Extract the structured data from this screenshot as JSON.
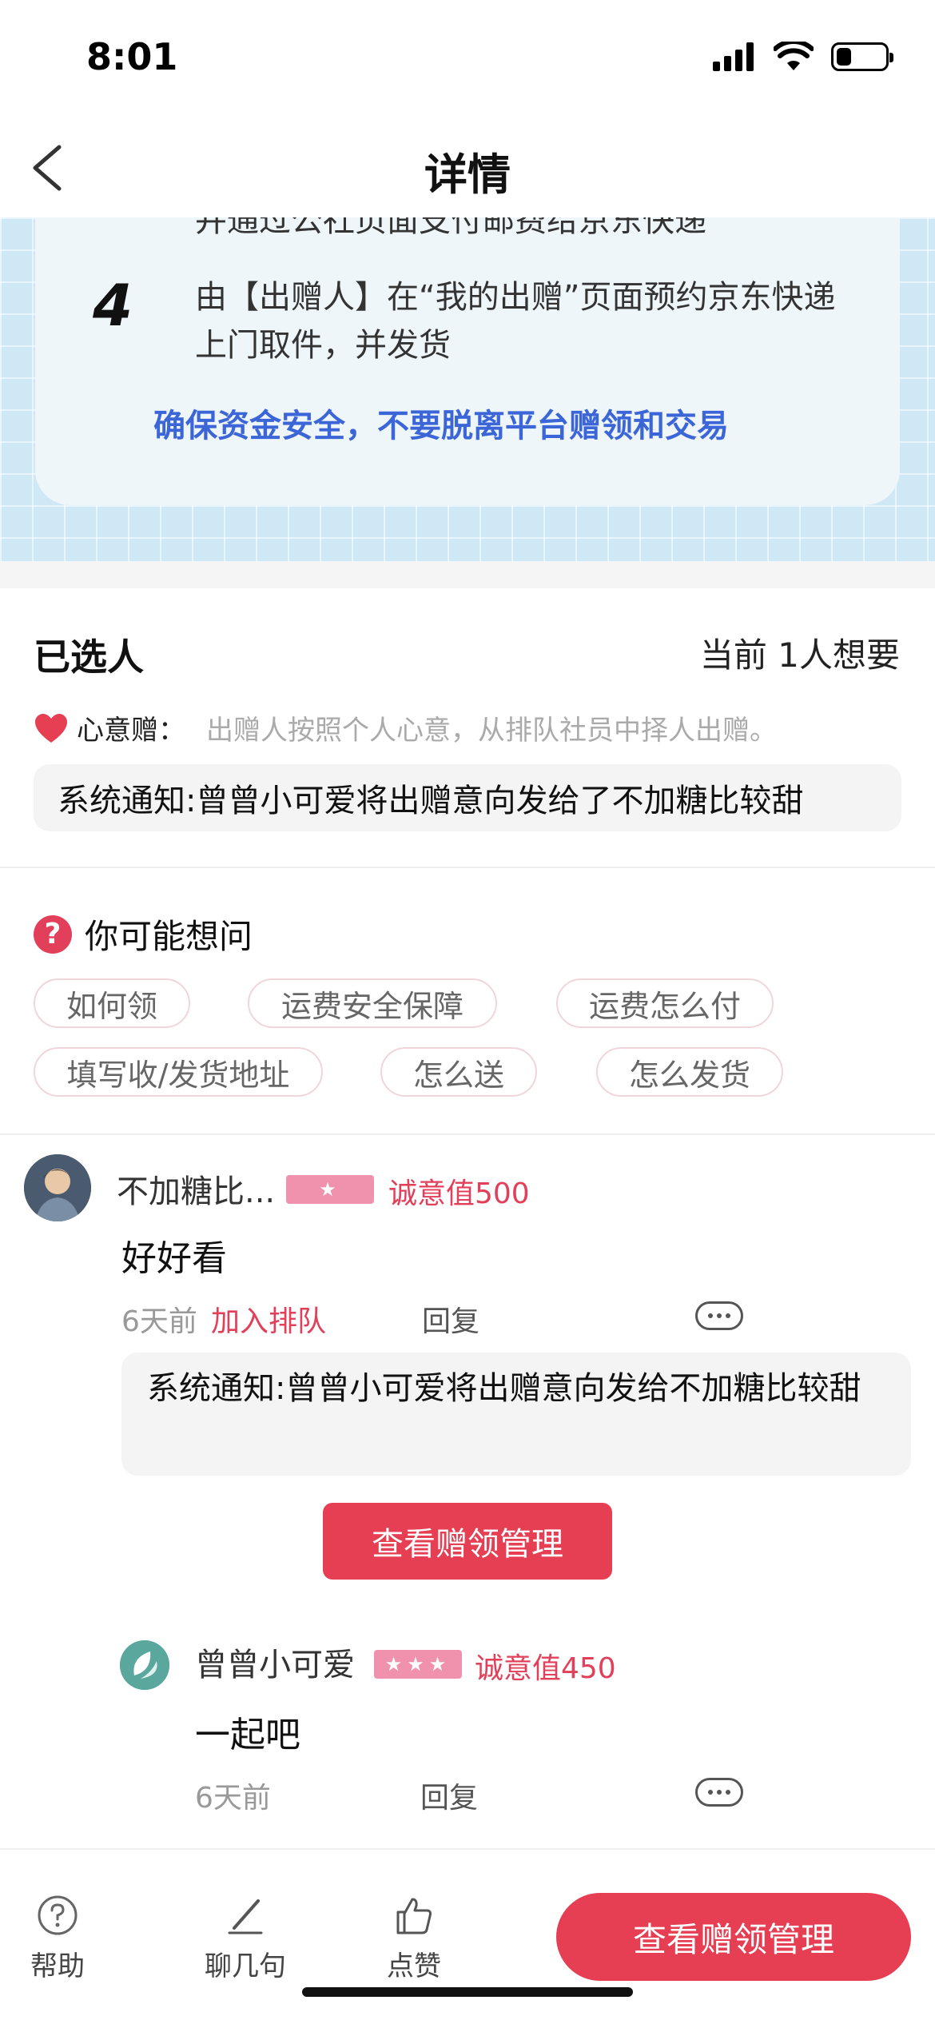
{
  "status": {
    "time": "8:01"
  },
  "nav": {
    "title": "详情"
  },
  "guide": {
    "step3_text": "并通过公社页面支付邮费给京东快递",
    "step4_num": "4",
    "step4_line1": "由【出赠人】在“我的出赠”页面预约京东快递",
    "step4_line2": "上门取件，并发货",
    "warning": "确保资金安全，不要脱离平台赠领和交易"
  },
  "selected": {
    "title": "已选人",
    "count": "当前 1人想要",
    "heart_label": "心意赠：",
    "heart_desc": "出赠人按照个人心意，从排队社员中择人出赠。",
    "notice": "系统通知:曾曾小可爱将出赠意向发给了不加糖比较甜"
  },
  "faq": {
    "title": "你可能想问",
    "chips": [
      "如何领",
      "运费安全保障",
      "运费怎么付",
      "填写收/发货地址",
      "怎么送",
      "怎么发货"
    ]
  },
  "comments": [
    {
      "name": "不加糖比...",
      "sincerity": "诚意值500",
      "text": "好好看",
      "time": "6天前",
      "join": "加入排队",
      "reply": "回复",
      "system": "系统通知:曾曾小可爱将出赠意向发给不加糖比较甜",
      "button": "查看赠领管理"
    },
    {
      "name": "曾曾小可爱",
      "sincerity": "诚意值450",
      "text": "一起吧",
      "time": "6天前",
      "reply": "回复"
    }
  ],
  "bottom": {
    "help": "帮助",
    "chat": "聊几句",
    "like": "点赞",
    "cta": "查看赠领管理"
  },
  "colors": {
    "accent": "#e63e52",
    "link_blue": "#3c66d8",
    "badge_pink": "#f091ad"
  },
  "icons": [
    "signal-icon",
    "wifi-icon",
    "battery-icon",
    "back-chevron-icon",
    "heart-icon",
    "question-icon",
    "more-dots-icon",
    "help-icon",
    "pen-icon",
    "thumbs-up-icon"
  ]
}
